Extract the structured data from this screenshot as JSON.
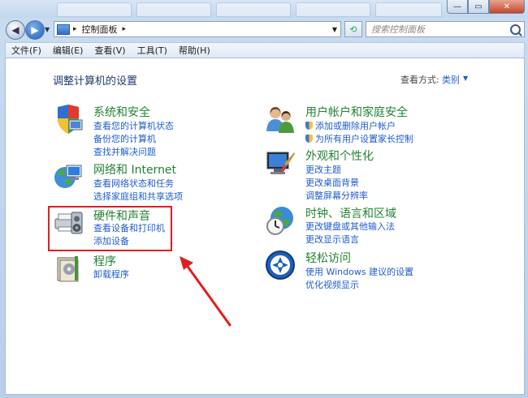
{
  "window": {
    "close_glyph": "✕",
    "restore_glyph": "▭",
    "minimize_glyph": "—"
  },
  "address": {
    "location": "控制面板",
    "search_placeholder": "搜索控制面板"
  },
  "menubar": [
    {
      "label": "文件(F)"
    },
    {
      "label": "编辑(E)"
    },
    {
      "label": "查看(V)"
    },
    {
      "label": "工具(T)"
    },
    {
      "label": "帮助(H)"
    }
  ],
  "page": {
    "heading": "调整计算机的设置",
    "view_by_label": "查看方式:",
    "view_by_value": "类别"
  },
  "categories": [
    {
      "title": "系统和安全",
      "icon": "system-security-icon",
      "links": [
        "查看您的计算机状态",
        "备份您的计算机",
        "查找并解决问题"
      ]
    },
    {
      "title": "网络和 Internet",
      "icon": "network-icon",
      "links": [
        "查看网络状态和任务",
        "选择家庭组和共享选项"
      ]
    },
    {
      "title": "硬件和声音",
      "icon": "hardware-sound-icon",
      "links": [
        "查看设备和打印机",
        "添加设备"
      ]
    },
    {
      "title": "程序",
      "icon": "programs-icon",
      "links": [
        "卸载程序"
      ]
    },
    {
      "title": "用户帐户和家庭安全",
      "icon": "user-accounts-icon",
      "links": [
        "添加或删除用户帐户",
        "为所有用户设置家长控制"
      ]
    },
    {
      "title": "外观和个性化",
      "icon": "appearance-icon",
      "links": [
        "更改主题",
        "更改桌面背景",
        "调整屏幕分辨率"
      ]
    },
    {
      "title": "时钟、语言和区域",
      "icon": "clock-language-icon",
      "links": [
        "更改键盘或其他输入法",
        "更改显示语言"
      ]
    },
    {
      "title": "轻松访问",
      "icon": "ease-of-access-icon",
      "links": [
        "使用 Windows 建议的设置",
        "优化视频显示"
      ]
    }
  ],
  "colors": {
    "category_title": "#238233",
    "link": "#1f5ccf",
    "heading": "#1f3a6e",
    "highlight": "#e01e1e"
  }
}
